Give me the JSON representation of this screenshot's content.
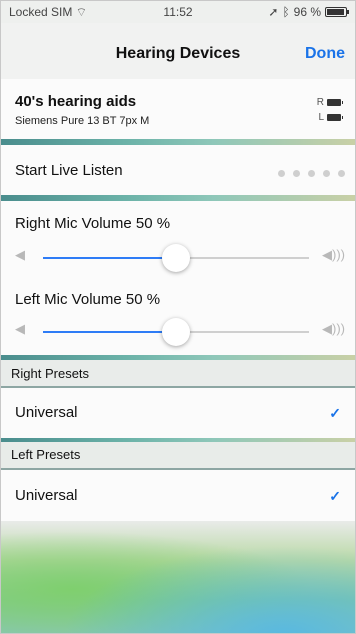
{
  "status_bar": {
    "carrier": "Locked SIM",
    "time": "11:52",
    "battery_text": "96 %"
  },
  "nav": {
    "title": "Hearing Devices",
    "done_label": "Done"
  },
  "device": {
    "name": "40's hearing aids",
    "model": "Siemens Pure 13 BT 7px M",
    "right_label": "R",
    "left_label": "L"
  },
  "live_listen": {
    "label": "Start Live Listen"
  },
  "right_mic": {
    "label": "Right Mic Volume  50 %",
    "level": 0.5
  },
  "left_mic": {
    "label": "Left Mic Volume  50 %",
    "level": 0.5
  },
  "right_presets": {
    "header": "Right Presets",
    "selected": "Universal"
  },
  "left_presets": {
    "header": "Left Presets",
    "selected": "Universal"
  },
  "colors": {
    "accent": "#1a73e8",
    "slider_fill": "#2e7cf6"
  }
}
